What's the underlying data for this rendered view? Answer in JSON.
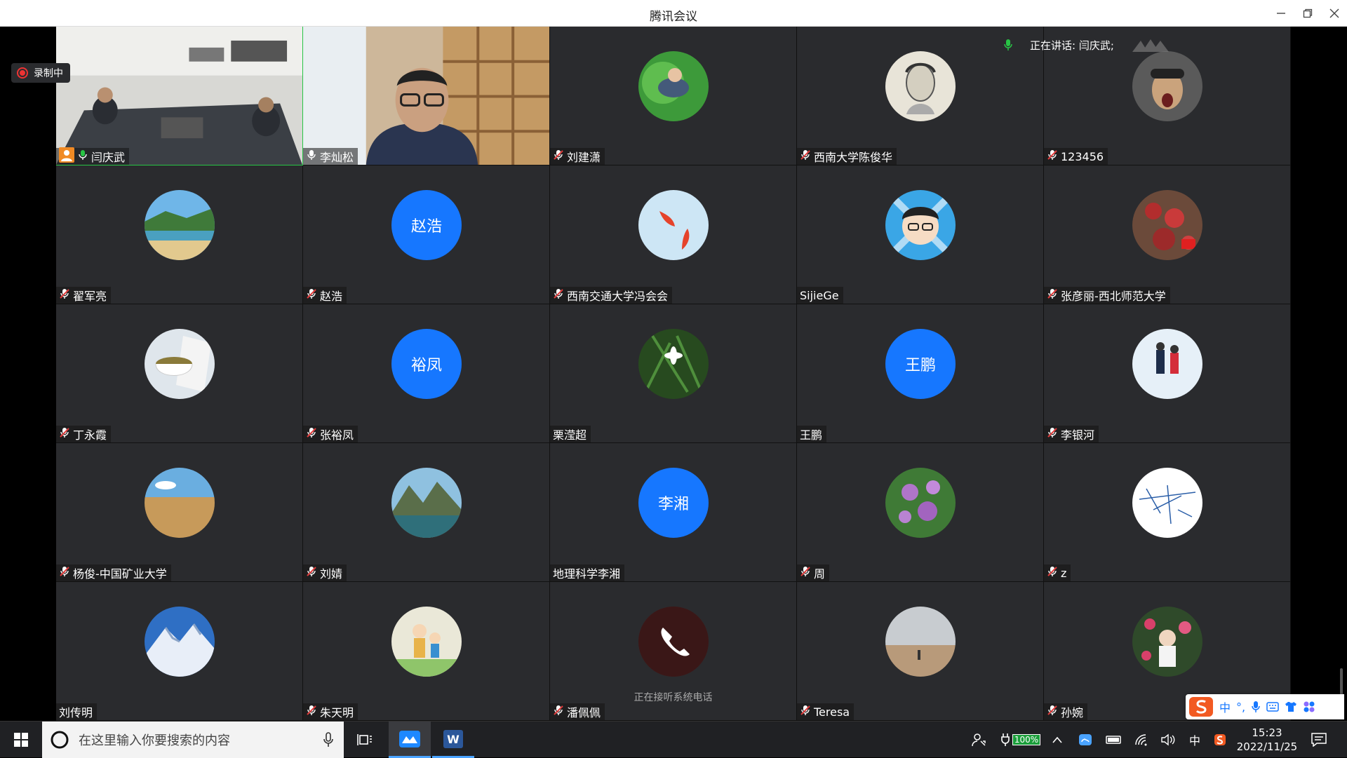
{
  "window": {
    "title": "腾讯会议"
  },
  "recording": {
    "label": "录制中"
  },
  "speaking": {
    "label": "正在讲话: 闫庆武;"
  },
  "colors": {
    "accent": "#1677ff",
    "tile_bg": "#2a2b2e",
    "muted_red": "#e03c3c",
    "mic_green": "#28c445"
  },
  "tiles": [
    {
      "name": "闫庆武",
      "mic": "active",
      "host": true,
      "type": "video-room"
    },
    {
      "name": "李灿松",
      "mic": "on",
      "type": "video-person"
    },
    {
      "name": "刘建潇",
      "mic": "muted",
      "avatar": "photo-child-grass"
    },
    {
      "name": "西南大学陈俊华",
      "mic": "muted",
      "avatar": "photo-sketch-portrait"
    },
    {
      "name": "123456",
      "mic": "muted",
      "avatar": "photo-goggles-kid"
    },
    {
      "name": "翟军亮",
      "mic": "muted",
      "avatar": "photo-beach"
    },
    {
      "name": "赵浩",
      "mic": "muted",
      "avatar_text": "赵浩"
    },
    {
      "name": "西南交通大学冯会会",
      "mic": "muted",
      "avatar": "photo-red-fish"
    },
    {
      "name": "SijieGe",
      "mic": "none",
      "avatar": "cartoon-boy-glasses"
    },
    {
      "name": "张彦丽-西北师范大学",
      "mic": "muted",
      "avatar": "photo-red-flowers"
    },
    {
      "name": "丁永霞",
      "mic": "muted",
      "avatar": "photo-tea-cup"
    },
    {
      "name": "张裕凤",
      "mic": "muted",
      "avatar_text": "裕凤"
    },
    {
      "name": "栗滢超",
      "mic": "none",
      "avatar": "photo-white-flower"
    },
    {
      "name": "王鹏",
      "mic": "none",
      "avatar_text": "王鹏"
    },
    {
      "name": "李银河",
      "mic": "muted",
      "avatar": "photo-snow-couple"
    },
    {
      "name": "杨俊-中国矿业大学",
      "mic": "muted",
      "avatar": "photo-wheat-field"
    },
    {
      "name": "刘婧",
      "mic": "muted",
      "avatar": "photo-mountain-lake"
    },
    {
      "name": "地理科学李湘",
      "mic": "none",
      "avatar_text": "李湘"
    },
    {
      "name": "周",
      "mic": "muted",
      "avatar": "photo-purple-flowers"
    },
    {
      "name": "z",
      "mic": "muted",
      "avatar": "sketch-blue-drawing"
    },
    {
      "name": "刘传明",
      "mic": "none",
      "avatar": "photo-snow-mountain"
    },
    {
      "name": "朱天明",
      "mic": "muted",
      "avatar": "cartoon-kids"
    },
    {
      "name": "潘佩佩",
      "mic": "muted",
      "avatar": "phone-call",
      "status": "正在接听系统电话"
    },
    {
      "name": "Teresa",
      "mic": "muted",
      "avatar": "photo-beach-person"
    },
    {
      "name": "孙婉",
      "mic": "muted",
      "avatar": "photo-child-flowers"
    }
  ],
  "taskbar": {
    "search_placeholder": "在这里输入你要搜索的内容",
    "battery": "100%",
    "ime_lang": "中",
    "time": "15:23",
    "date": "2022/11/25"
  },
  "ime_toolbar": {
    "lang": "中"
  }
}
